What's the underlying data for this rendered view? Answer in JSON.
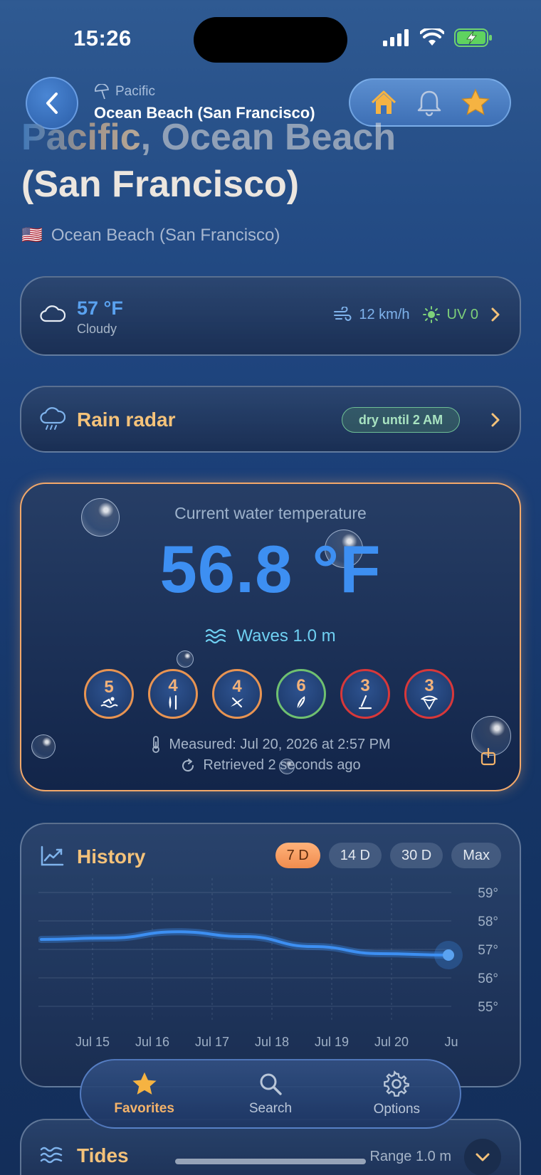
{
  "status_bar": {
    "time": "15:26"
  },
  "nav": {
    "region": "Pacific",
    "beach": "Ocean Beach (San Francisco)"
  },
  "heading": {
    "region": "Pacific",
    "separator": ", ",
    "name_part1": "Ocean Beach",
    "name_part2": "(San Francisco)"
  },
  "subline": {
    "flag": "🇺🇸",
    "text": "Ocean Beach (San Francisco)"
  },
  "weather": {
    "temp": "57 °F",
    "condition": "Cloudy",
    "wind": "12 km/h",
    "uv": "UV 0"
  },
  "rain": {
    "title": "Rain radar",
    "badge": "dry until 2 AM"
  },
  "water": {
    "label": "Current water temperature",
    "value": "56.8 °F",
    "waves": "Waves 1.0 m",
    "ratings": [
      {
        "value": "5",
        "icon": "swimming-icon",
        "color": "orange"
      },
      {
        "value": "4",
        "icon": "surfboard-icon",
        "color": "orange"
      },
      {
        "value": "4",
        "icon": "kayak-icon",
        "color": "orange"
      },
      {
        "value": "6",
        "icon": "surfboard-leaf-icon",
        "color": "green"
      },
      {
        "value": "3",
        "icon": "windsurf-icon",
        "color": "red"
      },
      {
        "value": "3",
        "icon": "kitesurf-icon",
        "color": "red"
      }
    ],
    "measured": "Measured: Jul 20, 2026 at 2:57 PM",
    "retrieved": "Retrieved 2 seconds ago"
  },
  "history": {
    "title": "History",
    "ranges": [
      "7 D",
      "14 D",
      "30 D",
      "Max"
    ],
    "active_range": "7 D"
  },
  "chart_data": {
    "type": "line",
    "title": "History",
    "x": [
      "Jul 14",
      "Jul 15",
      "Jul 16",
      "Jul 17",
      "Jul 18",
      "Jul 19",
      "Jul 20"
    ],
    "x_tick_labels": [
      "Jul 15",
      "Jul 16",
      "Jul 17",
      "Jul 18",
      "Jul 19",
      "Jul 20",
      "Ju"
    ],
    "series": [
      {
        "values": [
          57.35,
          57.4,
          57.62,
          57.45,
          57.1,
          56.85,
          56.8
        ]
      }
    ],
    "y_ticks": [
      "59°",
      "58°",
      "57°",
      "56°",
      "55°"
    ],
    "ylim": [
      55,
      59
    ],
    "grid": true,
    "colors": {
      "line": "#3d8ff2",
      "last_point": "#5aa2f0"
    }
  },
  "tabbar": {
    "items": [
      {
        "label": "Favorites",
        "icon": "star-icon",
        "active": true
      },
      {
        "label": "Search",
        "icon": "search-icon",
        "active": false
      },
      {
        "label": "Options",
        "icon": "gear-icon",
        "active": false
      }
    ]
  },
  "tides": {
    "title": "Tides",
    "range": "Range 1.0 m"
  },
  "colors": {
    "accent_orange": "#f4c27a",
    "accent_blue": "#3d8ff2",
    "uv_green": "#7ed07a",
    "rating_orange": "#e89452",
    "rating_green": "#6fc070",
    "rating_red": "#d8383a"
  }
}
